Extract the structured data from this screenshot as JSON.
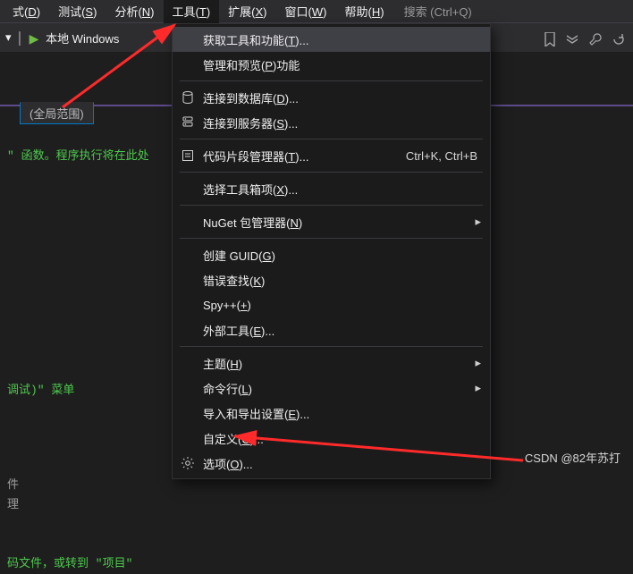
{
  "menubar": {
    "items": [
      {
        "pre": "式(",
        "u": "D",
        "post": ")"
      },
      {
        "pre": "测试(",
        "u": "S",
        "post": ")"
      },
      {
        "pre": "分析(",
        "u": "N",
        "post": ")"
      },
      {
        "pre": "工具(",
        "u": "T",
        "post": ")"
      },
      {
        "pre": "扩展(",
        "u": "X",
        "post": ")"
      },
      {
        "pre": "窗口(",
        "u": "W",
        "post": ")"
      },
      {
        "pre": "帮助(",
        "u": "H",
        "post": ")"
      }
    ],
    "search_hint": "搜索 (Ctrl+Q)"
  },
  "toolbar": {
    "run_label": "本地 Windows"
  },
  "scope": {
    "label": "(全局范围)"
  },
  "code": {
    "l1": "\" 函数。程序执行将在此处",
    "l4": "调试)\" 菜单",
    "l5a": "件",
    "l5b": "理",
    "l6": "码文件，或转到 \"项目\""
  },
  "dropdown": {
    "items": [
      {
        "pre": "获取工具和功能(",
        "u": "T",
        "post": ")...",
        "highlight": true
      },
      {
        "pre": "管理和预览(",
        "u": "P",
        "post": ")功能"
      },
      {
        "sep": true
      },
      {
        "pre": "连接到数据库(",
        "u": "D",
        "post": ")...",
        "icon": "db"
      },
      {
        "pre": "连接到服务器(",
        "u": "S",
        "post": ")...",
        "icon": "server"
      },
      {
        "sep": true
      },
      {
        "pre": "代码片段管理器(",
        "u": "T",
        "post": ")...",
        "shortcut": "Ctrl+K, Ctrl+B",
        "icon": "snippet"
      },
      {
        "sep": true
      },
      {
        "pre": "选择工具箱项(",
        "u": "X",
        "post": ")..."
      },
      {
        "sep": true
      },
      {
        "pre": "NuGet 包管理器(",
        "u": "N",
        "post": ")",
        "submenu": true
      },
      {
        "sep": true
      },
      {
        "pre": "创建 GUID(",
        "u": "G",
        "post": ")"
      },
      {
        "pre": "错误查找(",
        "u": "K",
        "post": ")"
      },
      {
        "pre": "Spy++(",
        "u": "+",
        "post": ")"
      },
      {
        "pre": "外部工具(",
        "u": "E",
        "post": ")..."
      },
      {
        "sep": true
      },
      {
        "pre": "主题(",
        "u": "H",
        "post": ")",
        "submenu": true
      },
      {
        "pre": "命令行(",
        "u": "L",
        "post": ")",
        "submenu": true
      },
      {
        "pre": "导入和导出设置(",
        "u": "E",
        "post": ")..."
      },
      {
        "pre": "自定义(",
        "u": "C",
        "post": ")..."
      },
      {
        "pre": "选项(",
        "u": "O",
        "post": ")...",
        "icon": "gear"
      }
    ]
  },
  "watermark": "CSDN @82年苏打"
}
